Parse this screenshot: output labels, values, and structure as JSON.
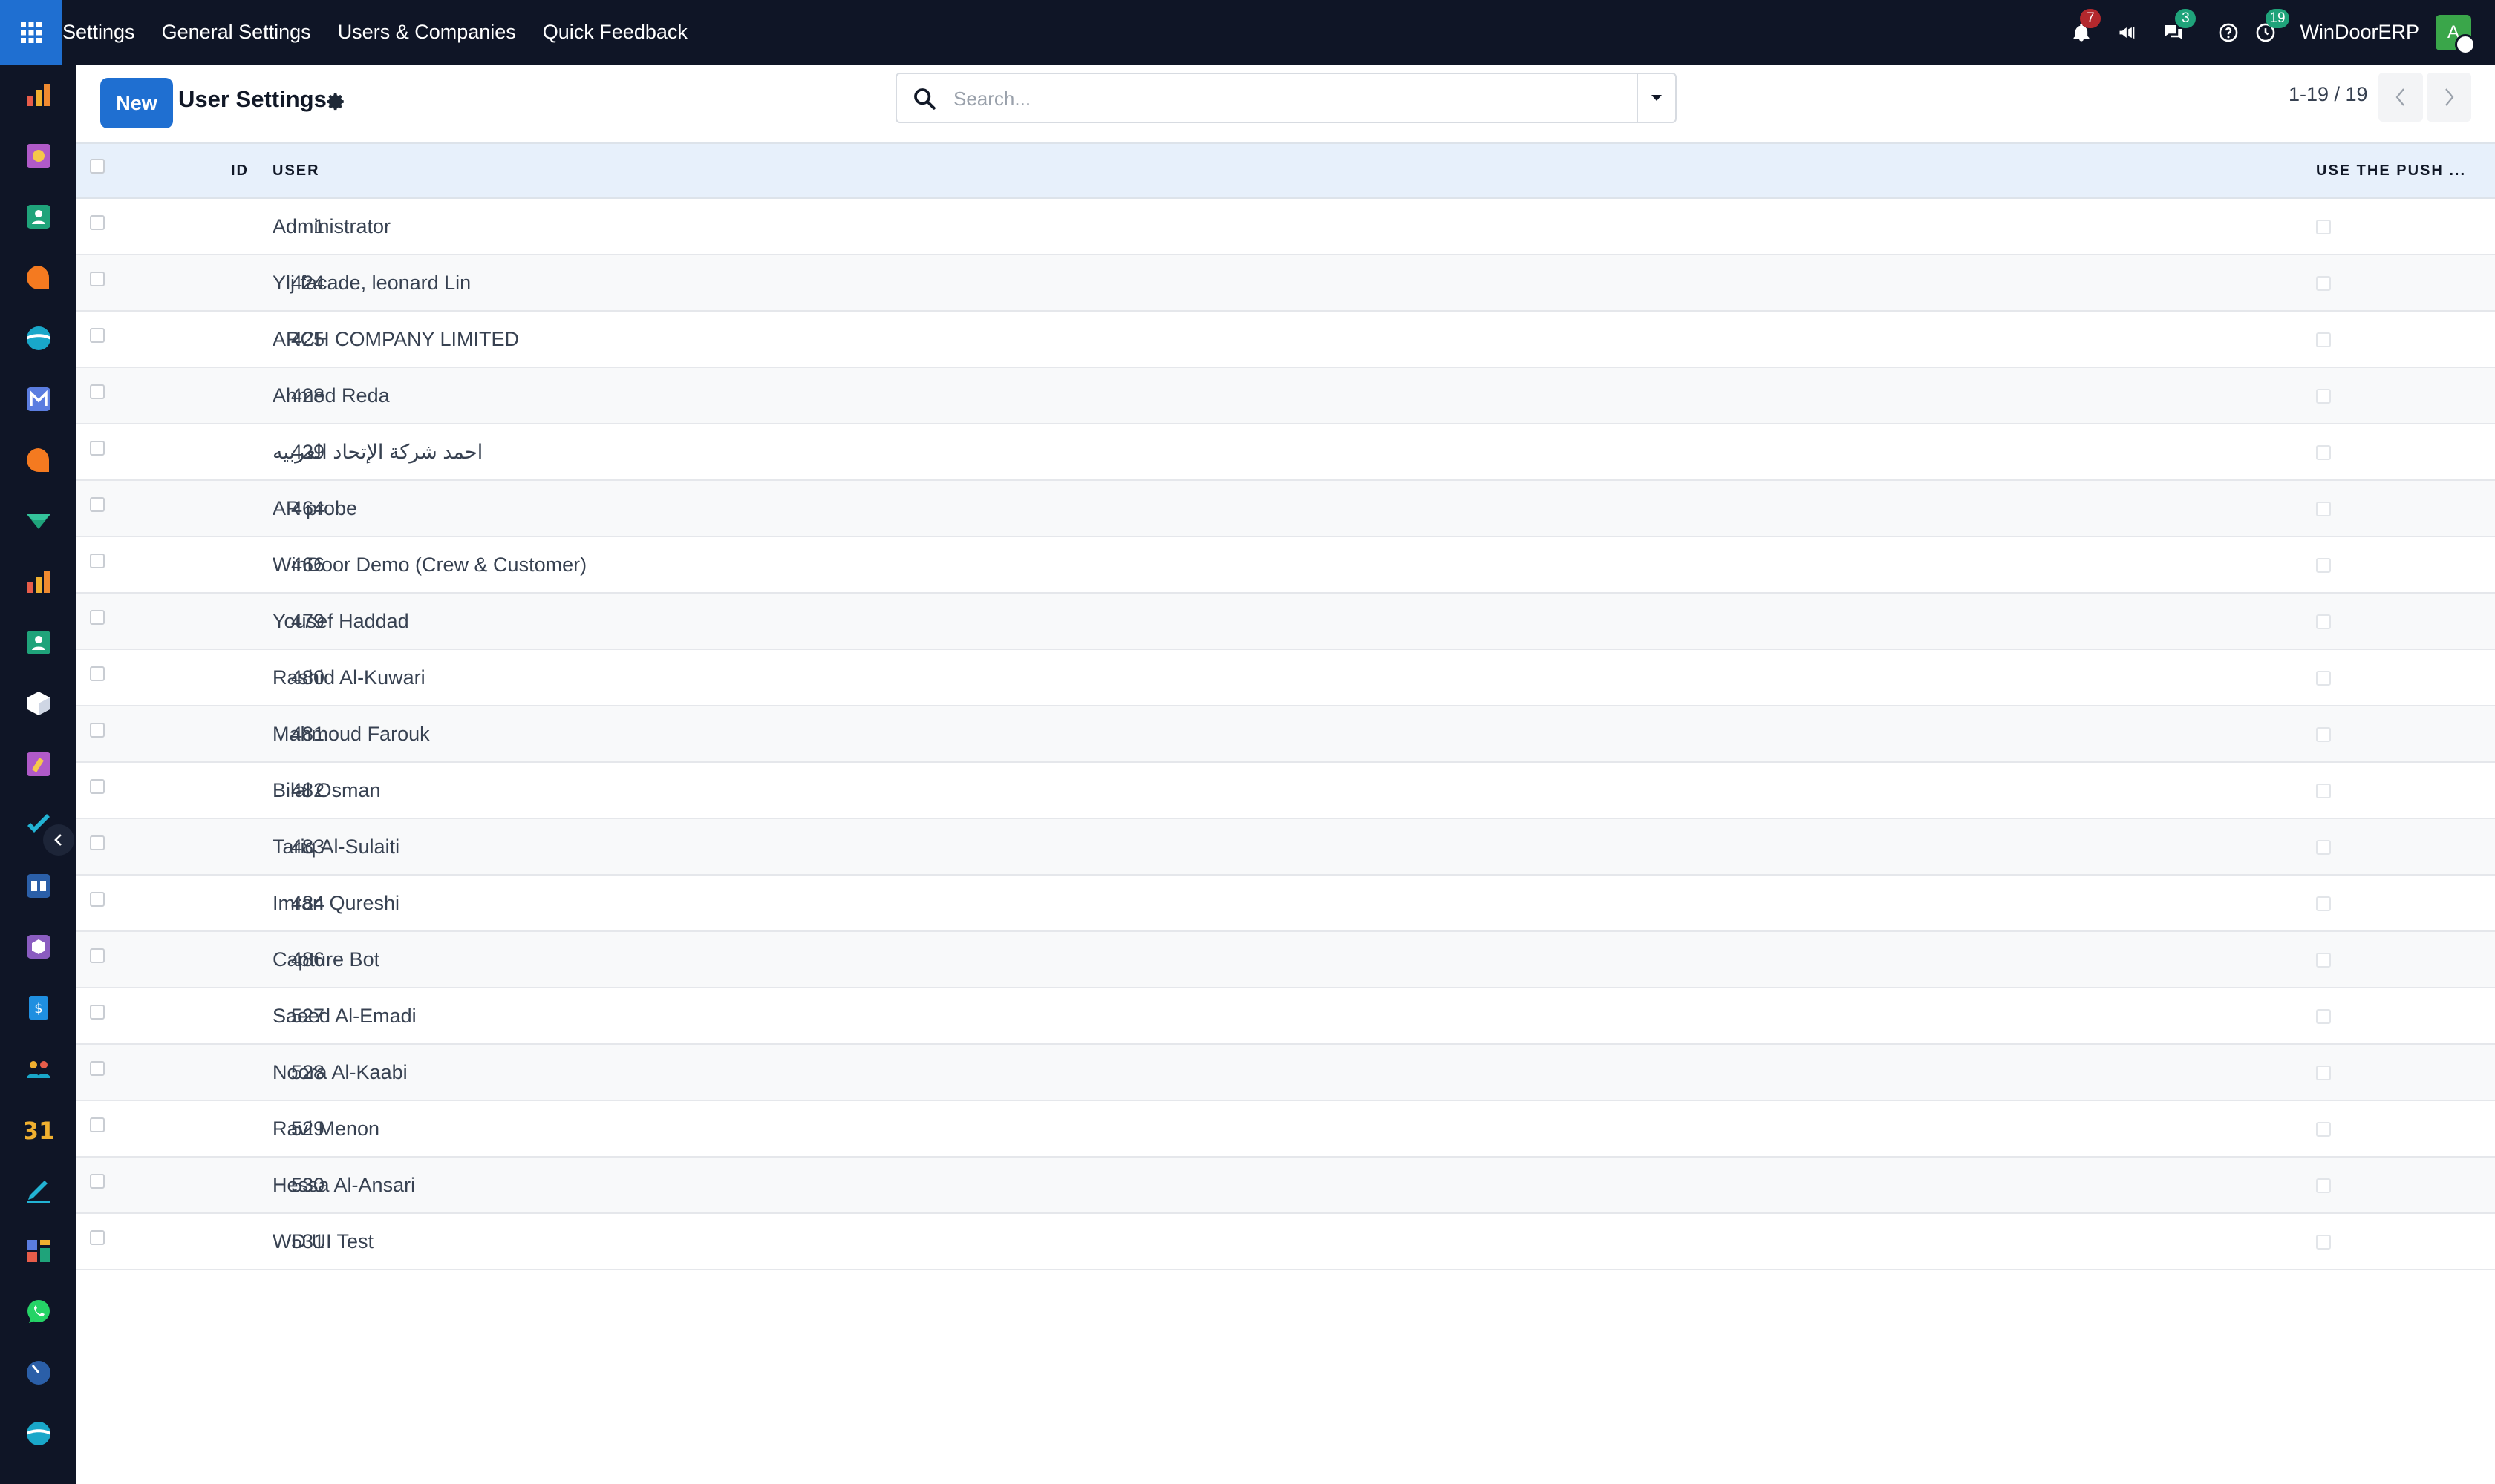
{
  "navbar": {
    "menu": [
      "Settings",
      "General Settings",
      "Users & Companies",
      "Quick Feedback"
    ],
    "notifications_count": "7",
    "messages_count": "3",
    "activities_count": "19",
    "company": "WinDoorERP",
    "avatar_letter": "A"
  },
  "control": {
    "new_label": "New",
    "title": "User Settings",
    "search_placeholder": "Search...",
    "pager": "1-19 / 19"
  },
  "table": {
    "headers": {
      "id": "ID",
      "user": "USER",
      "push": "USE THE PUSH ..."
    },
    "rows": [
      {
        "id": "1",
        "user": "Administrator"
      },
      {
        "id": "424",
        "user": "Ylj facade, leonard Lin"
      },
      {
        "id": "425",
        "user": "ARCH COMPANY LIMITED"
      },
      {
        "id": "428",
        "user": "Ahmed Reda"
      },
      {
        "id": "429",
        "user": "احمد شركة الإتحاد الغربيه"
      },
      {
        "id": "464",
        "user": "AR probe"
      },
      {
        "id": "466",
        "user": "WinDoor Demo (Crew & Customer)"
      },
      {
        "id": "479",
        "user": "Yousef Haddad"
      },
      {
        "id": "480",
        "user": "Rashid Al-Kuwari"
      },
      {
        "id": "481",
        "user": "Mahmoud Farouk"
      },
      {
        "id": "482",
        "user": "Bilal Osman"
      },
      {
        "id": "483",
        "user": "Tariq Al-Sulaiti"
      },
      {
        "id": "484",
        "user": "Imran Qureshi"
      },
      {
        "id": "486",
        "user": "Capture Bot"
      },
      {
        "id": "527",
        "user": "Saeed Al-Emadi"
      },
      {
        "id": "528",
        "user": "Noora Al-Kaabi"
      },
      {
        "id": "529",
        "user": "Ravi Menon"
      },
      {
        "id": "530",
        "user": "Hessa Al-Ansari"
      },
      {
        "id": "531",
        "user": "WD UI Test"
      }
    ]
  },
  "rail_apps": [
    "dashboards-icon",
    "appraisal-icon",
    "contacts-icon",
    "discuss-icon",
    "website-icon",
    "email-marketing-icon",
    "live-chat-icon",
    "field-service-icon",
    "spreadsheet-icon",
    "employees-icon",
    "inventory-icon",
    "appraisal-icon",
    "project-icon",
    "knowledge-icon",
    "products-icon",
    "invoicing-icon",
    "team-icon",
    "calendar-icon",
    "sign-icon",
    "dashboard-builder-icon",
    "whatsapp-icon",
    "timer-icon",
    "website-icon"
  ],
  "colors": {
    "navbar": "#0f1526",
    "primary": "#1f6fd1",
    "header_row": "#e7f0fb",
    "badge_red": "#b3282d",
    "badge_green": "#1fa37a"
  }
}
